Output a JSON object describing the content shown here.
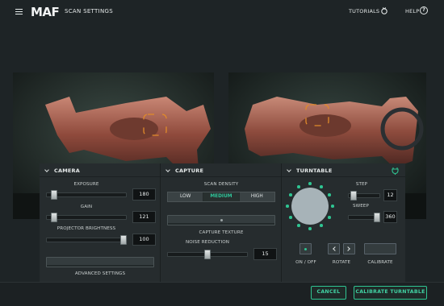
{
  "header": {
    "logo": "MAF",
    "title": "SCAN SETTINGS",
    "tutorials_label": "TUTORIALS",
    "help_label": "HELP",
    "help_icon_glyph": "?"
  },
  "views": {
    "left_icon": "part-camera-feed-left",
    "right_icon": "part-camera-feed-right"
  },
  "camera": {
    "title": "CAMERA",
    "exposure_label": "EXPOSURE",
    "exposure_value": "180",
    "exposure_level": 0.07,
    "gain_label": "GAIN",
    "gain_value": "121",
    "gain_level": 0.06,
    "projector_label": "PROJECTOR BRIGHTNESS",
    "projector_value": "100",
    "projector_level": 1.0,
    "advanced_label": "ADVANCED SETTINGS"
  },
  "capture": {
    "title": "CAPTURE",
    "density_label": "SCAN DENSITY",
    "density_options": [
      "LOW",
      "MEDIUM",
      "HIGH"
    ],
    "density_selected": "MEDIUM",
    "texture_label": "CAPTURE TEXTURE",
    "noise_label": "NOISE REDUCTION",
    "noise_value": "15",
    "noise_level": 0.5
  },
  "turntable": {
    "title": "TURNTABLE",
    "step_label": "STEP",
    "step_value": "12",
    "step_level": 0.1,
    "sweep_label": "SWEEP",
    "sweep_value": "360",
    "sweep_level": 1.0,
    "onoff_label": "ON / OFF",
    "rotate_label": "ROTATE",
    "calibrate_label": "CALIBRATE",
    "accent": "#2fc592"
  },
  "footer": {
    "cancel_label": "CANCEL",
    "calibrate_label": "CALIBRATE TURNTABLE"
  },
  "colors": {
    "accent": "#2fc592",
    "background": "#1e2426",
    "panel": "#262c2e"
  }
}
